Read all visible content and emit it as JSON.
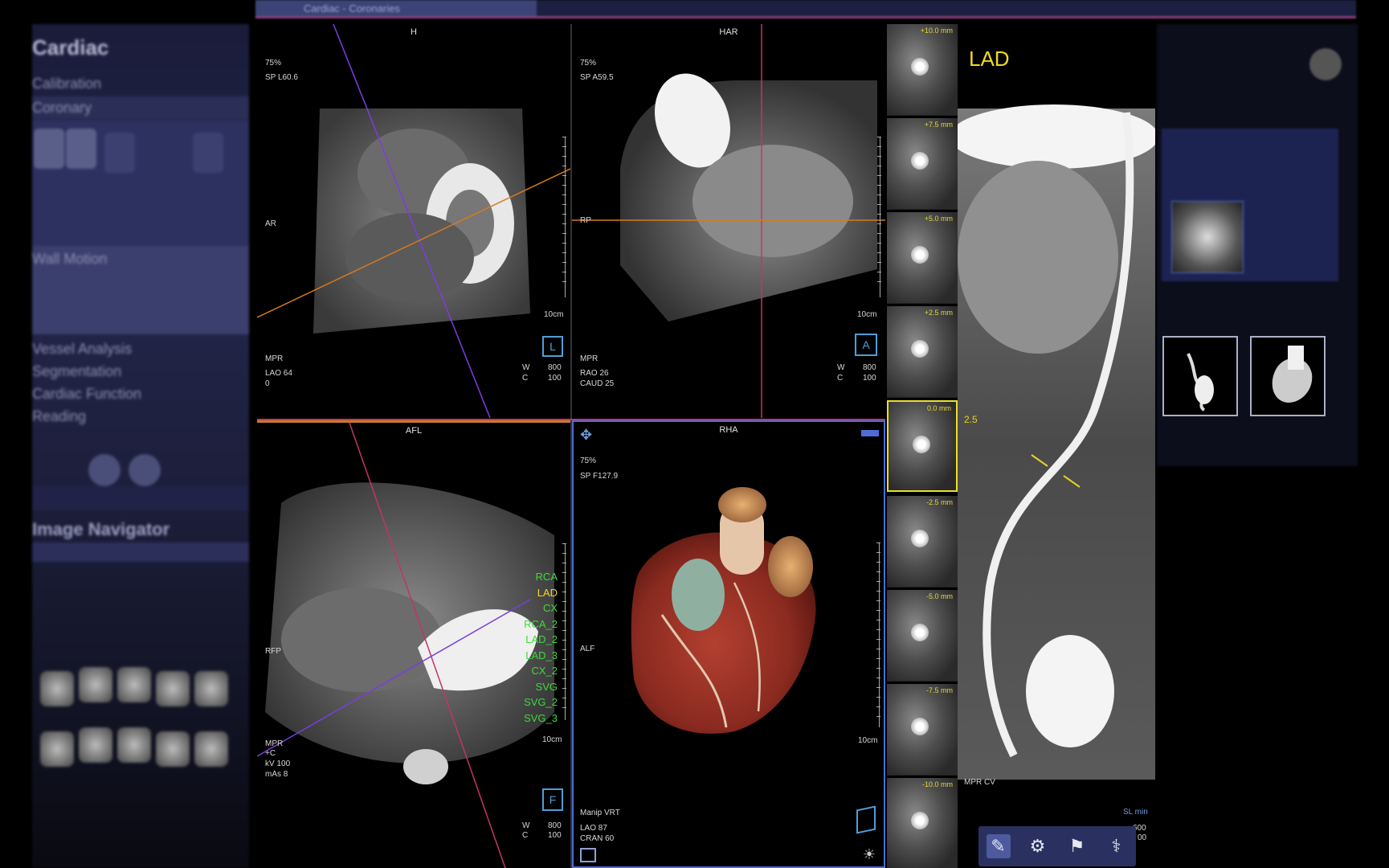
{
  "top_tab": "Cardiac - Coronaries",
  "left_panel": {
    "title": "Cardiac",
    "rows": [
      "Calibration",
      "Coronary",
      "Wall Motion",
      "Vessel Analysis",
      "Segmentation",
      "Cardiac Function",
      "Reading"
    ],
    "navigator_title": "Image Navigator"
  },
  "viewport_h": {
    "header": "H",
    "phase": "75%",
    "slice_pos": "SP L60.6",
    "orientation_left": "AR",
    "mode": "MPR",
    "angle1": "LAO 64",
    "angle2": "0",
    "window_label": "W",
    "window_value": "800",
    "center_label": "C",
    "center_value": "100",
    "scale": "10cm"
  },
  "viewport_har": {
    "header": "HAR",
    "phase": "75%",
    "slice_pos": "SP A59.5",
    "orientation_left": "RP",
    "mode": "MPR",
    "angle1": "RAO 26",
    "angle2": "CAUD 25",
    "window_label": "W",
    "window_value": "800",
    "center_label": "C",
    "center_value": "100",
    "scale": "10cm"
  },
  "viewport_afl": {
    "header": "AFL",
    "orientation_left": "RFP",
    "mode": "MPR",
    "contrast": "+C",
    "kv": "kV 100",
    "mas": "mAs 8",
    "window_label": "W",
    "window_value": "800",
    "center_label": "C",
    "center_value": "100",
    "scale": "10cm",
    "vessels": [
      "RCA",
      "LAD",
      "CX",
      "RCA_2",
      "LAD_2",
      "LAD_3",
      "CX_2",
      "SVG",
      "SVG_2",
      "SVG_3"
    ]
  },
  "viewport_rha": {
    "header": "RHA",
    "phase": "75%",
    "slice_pos": "SP F127.9",
    "orientation_left": "ALF",
    "mode": "Manip VRT",
    "angle1": "LAO 87",
    "angle2": "CRAN 60",
    "scale": "10cm"
  },
  "stack": {
    "offsets": [
      "+10.0 mm",
      "+7.5 mm",
      "+5.0 mm",
      "+2.5 mm",
      "0.0 mm",
      "-2.5 mm",
      "-5.0 mm",
      "-7.5 mm",
      "-10.0 mm"
    ],
    "selected_index": 4
  },
  "cpr": {
    "vessel": "LAD",
    "marker": "2.5",
    "mode": "MPR CV",
    "slab": "SL min",
    "window_value": "600",
    "center_value": "00"
  },
  "toolbar_icons": [
    "measure-icon",
    "gear-icon",
    "flag-icon",
    "vessel-tool-icon"
  ],
  "colors": {
    "vessel_label": "#3ed93e",
    "active_vessel": "#f2d81e",
    "accent_blue": "#4f6cd6",
    "pink_line": "#c2346a",
    "orange_line": "#d77a1e",
    "purple_line": "#7a3ee0"
  }
}
